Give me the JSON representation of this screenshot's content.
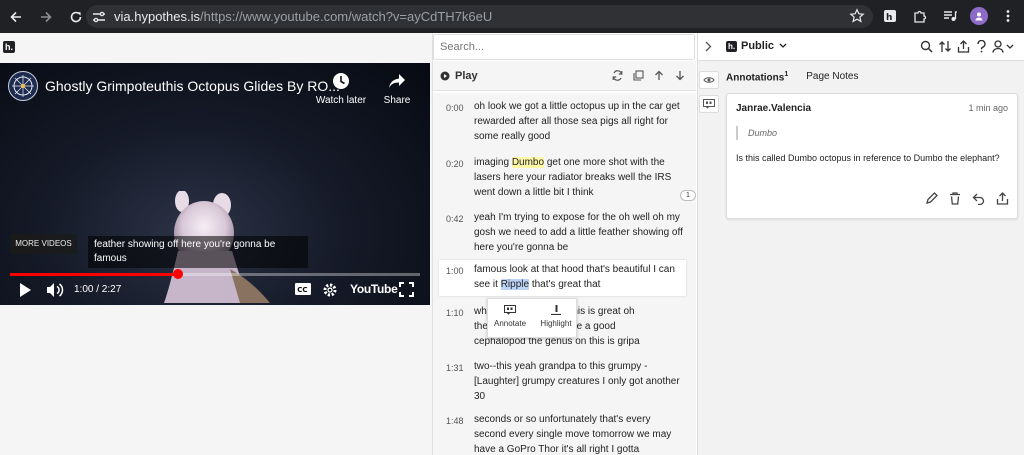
{
  "browser": {
    "url_host": "via.hypothes.is",
    "url_path": "/https://www.youtube.com/watch?v=ayCdTH7k6eU"
  },
  "video": {
    "title": "Ghostly Grimpoteuthis Octopus Glides By RO...",
    "watch_later_label": "Watch later",
    "share_label": "Share",
    "more_videos_label": "MORE VIDEOS",
    "caption": "feather showing off here you're gonna be famous",
    "time_display": "1:00 / 2:27",
    "progress": 0.41,
    "brand": "YouTube"
  },
  "transcript_panel": {
    "search_placeholder": "Search...",
    "play_label": "Play",
    "segments": [
      {
        "time": "0:00",
        "pre": "oh look we got a little octopus up in the car get rewarded after all those sea pigs all right for some really good",
        "mark": "",
        "post": ""
      },
      {
        "time": "0:20",
        "pre": "imaging ",
        "mark": "Dumbo",
        "post": " get one more shot with the lasers here your radiator breaks well the IRS went down a little bit I think"
      },
      {
        "time": "0:42",
        "pre": "yeah I'm trying to expose for the oh well oh my gosh we need to add a little feather showing off here you're gonna be",
        "mark": "",
        "post": ""
      },
      {
        "time": "1:00",
        "pre": "famous look at that hood that's beautiful I can see it ",
        "mark": "Ripple",
        "post": " that's great that"
      },
      {
        "time": "1:10",
        "pre": "wh",
        "mid": "y this is great oh",
        "line2a": "the",
        "line2b": "e me a good",
        "line3": "cephalopod the genus on this is gripa"
      },
      {
        "time": "1:31",
        "pre": "two--this yeah grandpa to this grumpy - [Laughter] grumpy creatures I only got another 30",
        "mark": "",
        "post": ""
      },
      {
        "time": "1:48",
        "pre": "seconds or so unfortunately that's every second every single move tomorrow we may have a GoPro Thor it's all right I gotta",
        "mark": "",
        "post": ""
      }
    ],
    "annotate_label": "Annotate",
    "highlight_label": "Highlight",
    "anchor_count": "1"
  },
  "sidebar": {
    "group_label": "Public",
    "tabs": [
      {
        "label": "Annotations",
        "count": "1"
      },
      {
        "label": "Page Notes"
      }
    ],
    "annotation": {
      "user": "Janrae.Valencia",
      "time": "1 min ago",
      "quote": "Dumbo",
      "body": "Is this called Dumbo octopus in reference to Dumbo the elephant?"
    }
  }
}
